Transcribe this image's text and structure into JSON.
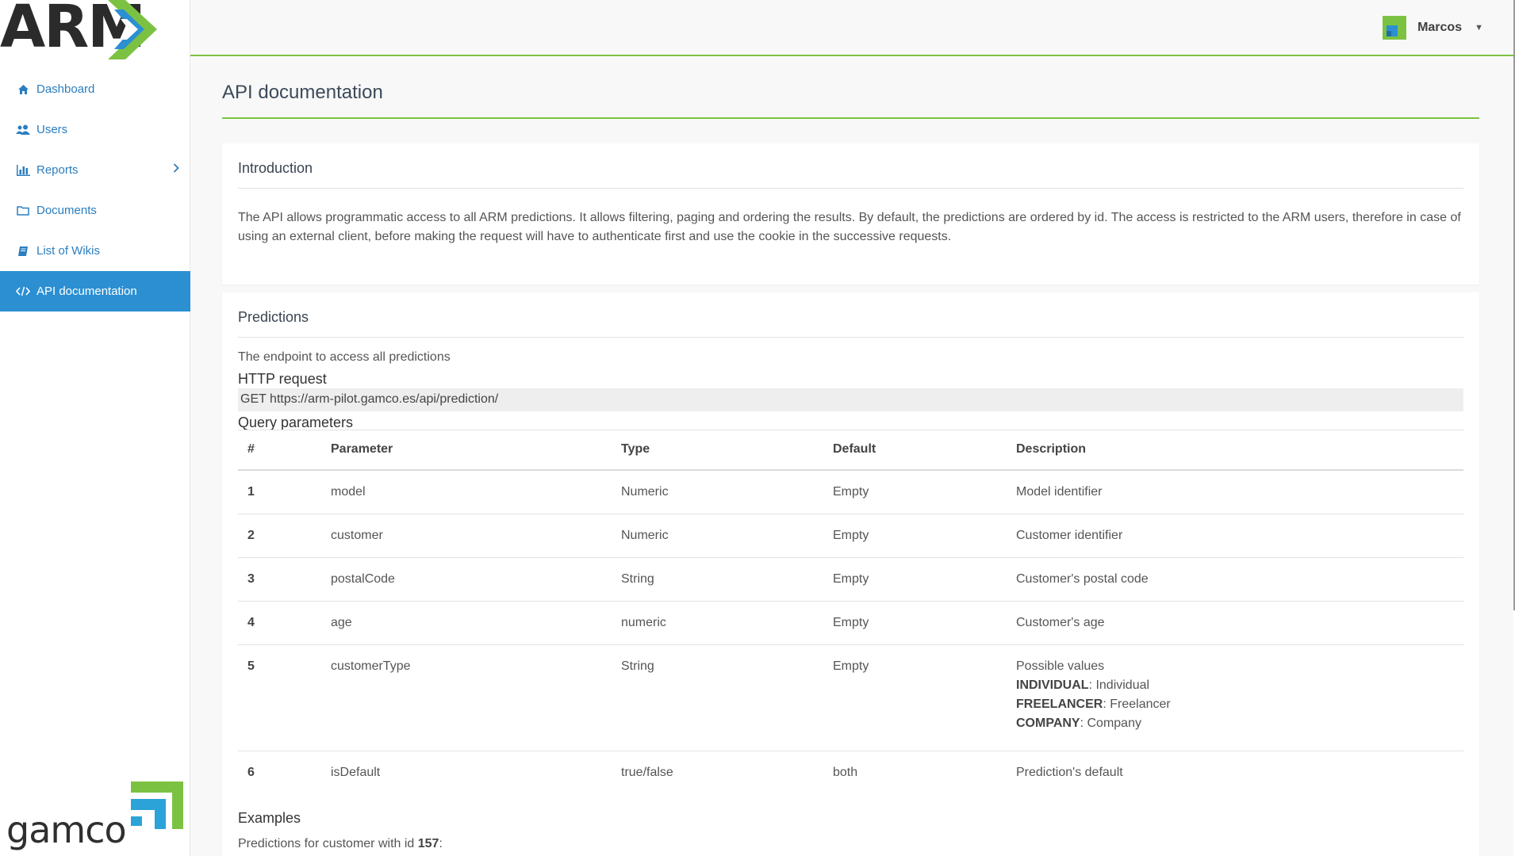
{
  "logo": {
    "text": "ARM",
    "icon": "arm-chevron-logo"
  },
  "sidebar": {
    "items": [
      {
        "label": "Dashboard",
        "icon": "home-icon"
      },
      {
        "label": "Users",
        "icon": "users-icon"
      },
      {
        "label": "Reports",
        "icon": "bar-chart-icon"
      },
      {
        "label": "Documents",
        "icon": "folder-icon"
      },
      {
        "label": "List of Wikis",
        "icon": "book-icon"
      },
      {
        "label": "API documentation",
        "icon": "code-icon",
        "active": true
      }
    ],
    "footer_logo": "gamco"
  },
  "topbar": {
    "user_name": "Marcos",
    "accent_color": "#7cc242"
  },
  "page": {
    "title": "API documentation",
    "intro": {
      "title": "Introduction",
      "text": "The API allows programmatic access to all ARM predictions. It allows filtering, paging and ordering the results. By default, the predictions are ordered by id. The access is restricted to the ARM users, therefore in case of using an external client, before making the request will have to authenticate first and use the cookie in the successive requests."
    },
    "predictions": {
      "title": "Predictions",
      "endpoint_text": "The endpoint to access all predictions",
      "http_heading": "HTTP request",
      "http_request": "GET https://arm-pilot.gamco.es/api/prediction/",
      "query_heading": "Query parameters",
      "columns": [
        "#",
        "Parameter",
        "Type",
        "Default",
        "Description"
      ],
      "rows": [
        {
          "n": "1",
          "param": "model",
          "type": "Numeric",
          "default": "Empty",
          "desc": "Model identifier"
        },
        {
          "n": "2",
          "param": "customer",
          "type": "Numeric",
          "default": "Empty",
          "desc": "Customer identifier"
        },
        {
          "n": "3",
          "param": "postalCode",
          "type": "String",
          "default": "Empty",
          "desc": "Customer's postal code"
        },
        {
          "n": "4",
          "param": "age",
          "type": "numeric",
          "default": "Empty",
          "desc": "Customer's age"
        },
        {
          "n": "5",
          "param": "customerType",
          "type": "String",
          "default": "Empty",
          "desc": "Possible values",
          "values": [
            {
              "key": "INDIVIDUAL",
              "label": ": Individual"
            },
            {
              "key": "FREELANCER",
              "label": ": Freelancer"
            },
            {
              "key": "COMPANY",
              "label": ": Company"
            }
          ]
        },
        {
          "n": "6",
          "param": "isDefault",
          "type": "true/false",
          "default": "both",
          "desc": "Prediction's default"
        }
      ],
      "examples_heading": "Examples",
      "example_text": "Predictions for customer with id ",
      "example_id": "157",
      "example_suffix": ":"
    }
  }
}
